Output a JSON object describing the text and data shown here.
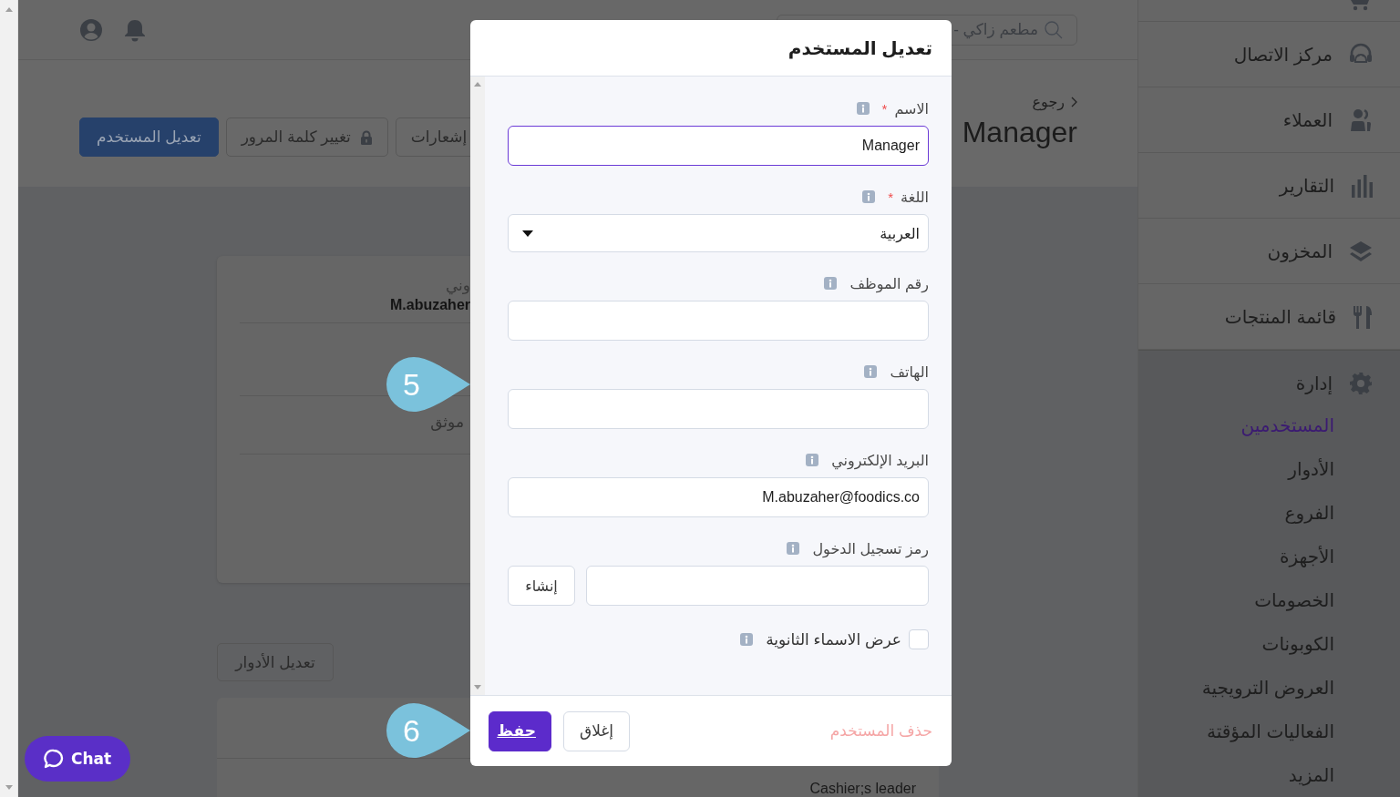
{
  "header": {
    "search": {
      "placeholder": "مطعم زاكي -"
    }
  },
  "page_header": {
    "back_link": "رجوع",
    "title": "Manager",
    "actions": [
      {
        "label": "إشعارات",
        "kind": "plain"
      },
      {
        "label": "تغيير كلمة المرور",
        "kind": "lock"
      },
      {
        "label": "تعديل المستخدم",
        "kind": "primary"
      }
    ]
  },
  "profile_card": {
    "field_label": "وني",
    "email": "M.abuzaher",
    "status": "موثق"
  },
  "roles_button": "تعديل الأدوار",
  "roles_card": {
    "role": "Cashier;s leader"
  },
  "sidebar": {
    "items": [
      {
        "label": "مركز الاتصال"
      },
      {
        "label": "العملاء"
      },
      {
        "label": "التقارير"
      },
      {
        "label": "المخزون"
      },
      {
        "label": "قائمة المنتجات"
      },
      {
        "label": "إدارة",
        "expanded": true,
        "children": [
          {
            "label": "المستخدمين",
            "selected": true
          },
          {
            "label": "الأدوار",
            "selected": false
          },
          {
            "label": "الفروع",
            "selected": false
          },
          {
            "label": "الأجهزة",
            "selected": false
          },
          {
            "label": "الخصومات",
            "selected": false
          },
          {
            "label": "الكوبونات",
            "selected": false
          },
          {
            "label": "العروض الترويجية",
            "selected": false
          },
          {
            "label": "الفعاليات المؤقتة",
            "selected": false
          },
          {
            "label": "المزيد",
            "selected": false
          }
        ]
      }
    ]
  },
  "dialog": {
    "title": "تعديل المستخدم",
    "fields": [
      {
        "kind": "text",
        "label": "الاسم",
        "required_mark": "*",
        "value": "Manager",
        "focused": true
      },
      {
        "kind": "select",
        "label": "اللغة",
        "required_mark": "*",
        "value": "العربية",
        "focused": false
      },
      {
        "kind": "text",
        "label": "رقم الموظف",
        "focused": false
      },
      {
        "kind": "text",
        "label": "الهاتف",
        "focused": false
      },
      {
        "kind": "text",
        "label": "البريد الإلكتروني",
        "value": "M.abuzaher@foodics.co",
        "focused": false
      },
      {
        "kind": "generate",
        "label": "رمز تسجيل الدخول",
        "button": "إنشاء",
        "focused": false
      },
      {
        "kind": "checkbox",
        "label": "عرض الاسماء الثانوية",
        "checked": false
      }
    ],
    "delete_link": "حذف المستخدم",
    "buttons": [
      {
        "label": "إغلاق",
        "kind": "secondary"
      },
      {
        "label": "حفظ",
        "kind": "primary"
      }
    ]
  },
  "callouts": [
    "5",
    "6"
  ],
  "chat_button": {
    "label": "Chat"
  }
}
